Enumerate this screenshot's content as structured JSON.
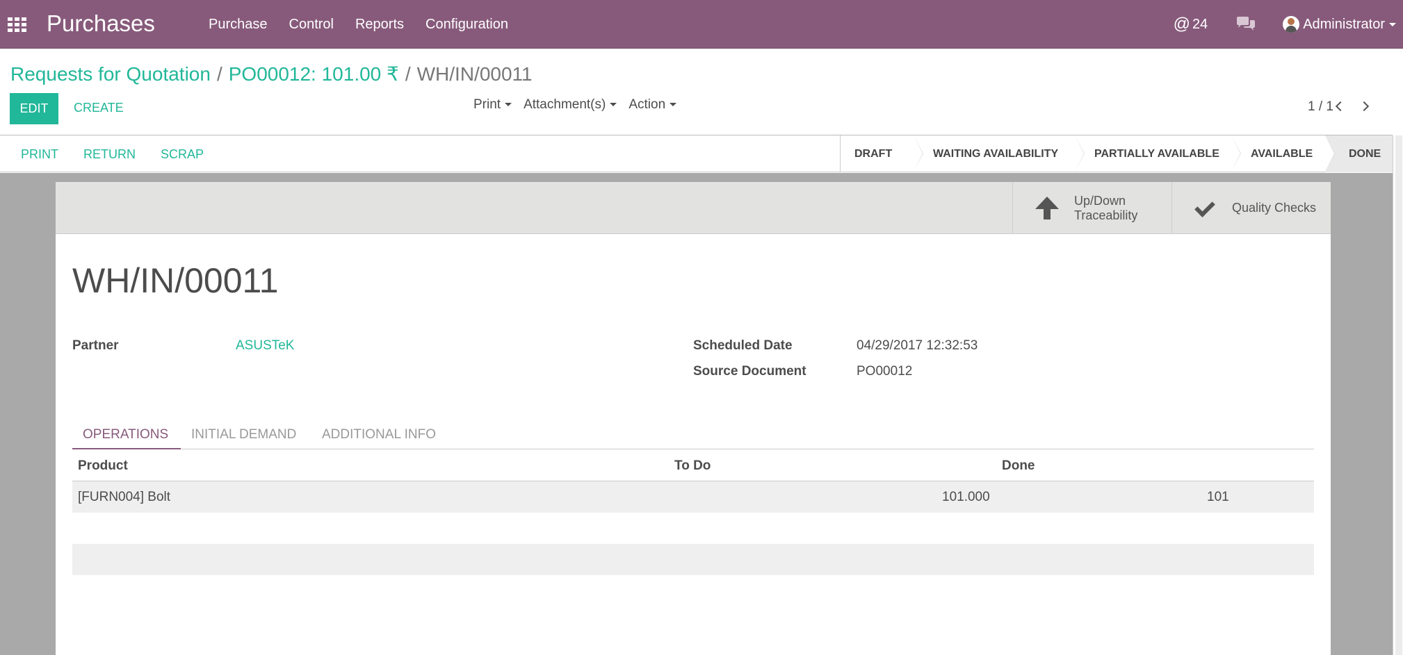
{
  "navbar": {
    "app_name": "Purchases",
    "menu": [
      "Purchase",
      "Control",
      "Reports",
      "Configuration"
    ],
    "notifications_count": "24",
    "user_name": "Administrator"
  },
  "breadcrumb": {
    "items": [
      "Requests for Quotation",
      "PO00012: 101.00 ₹"
    ],
    "current": "WH/IN/00011"
  },
  "control_panel": {
    "edit_label": "EDIT",
    "create_label": "CREATE",
    "sidebar_menus": [
      "Print",
      "Attachment(s)",
      "Action"
    ],
    "pager": "1 / 1"
  },
  "header": {
    "buttons": [
      "PRINT",
      "RETURN",
      "SCRAP"
    ],
    "stages": [
      "DRAFT",
      "WAITING AVAILABILITY",
      "PARTIALLY AVAILABLE",
      "AVAILABLE",
      "DONE"
    ],
    "active_stage": "DONE"
  },
  "smart_buttons": {
    "traceability_line1": "Up/Down",
    "traceability_line2": "Traceability",
    "quality": "Quality Checks"
  },
  "form": {
    "title": "WH/IN/00011",
    "partner_label": "Partner",
    "partner_value": "ASUSTeK",
    "scheduled_date_label": "Scheduled Date",
    "scheduled_date_value": "04/29/2017 12:32:53",
    "source_document_label": "Source Document",
    "source_document_value": "PO00012"
  },
  "tabs": [
    "OPERATIONS",
    "INITIAL DEMAND",
    "ADDITIONAL INFO"
  ],
  "operations_table": {
    "columns": [
      "Product",
      "To Do",
      "Done"
    ],
    "rows": [
      {
        "product": "[FURN004] Bolt",
        "todo": "101.000",
        "done": "101"
      }
    ]
  },
  "colors": {
    "brand": "#875a7b",
    "accent": "#21b799"
  }
}
